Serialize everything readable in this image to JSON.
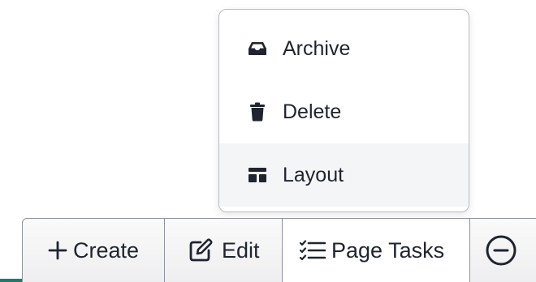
{
  "menu": {
    "items": [
      {
        "label": "Archive",
        "icon": "archive-icon"
      },
      {
        "label": "Delete",
        "icon": "trash-icon"
      },
      {
        "label": "Layout",
        "icon": "layout-icon"
      }
    ],
    "highlighted": "Layout"
  },
  "toolbar": {
    "create_label": "Create",
    "edit_label": "Edit",
    "tasks_label": "Page Tasks",
    "more_icon": "minus-circle-icon"
  },
  "colors": {
    "text": "#1f2430",
    "menu_border": "#b9bcc3",
    "toolbar_border": "#8f939b",
    "highlight": "#f4f5f7",
    "accent": "#1e7a6d"
  }
}
